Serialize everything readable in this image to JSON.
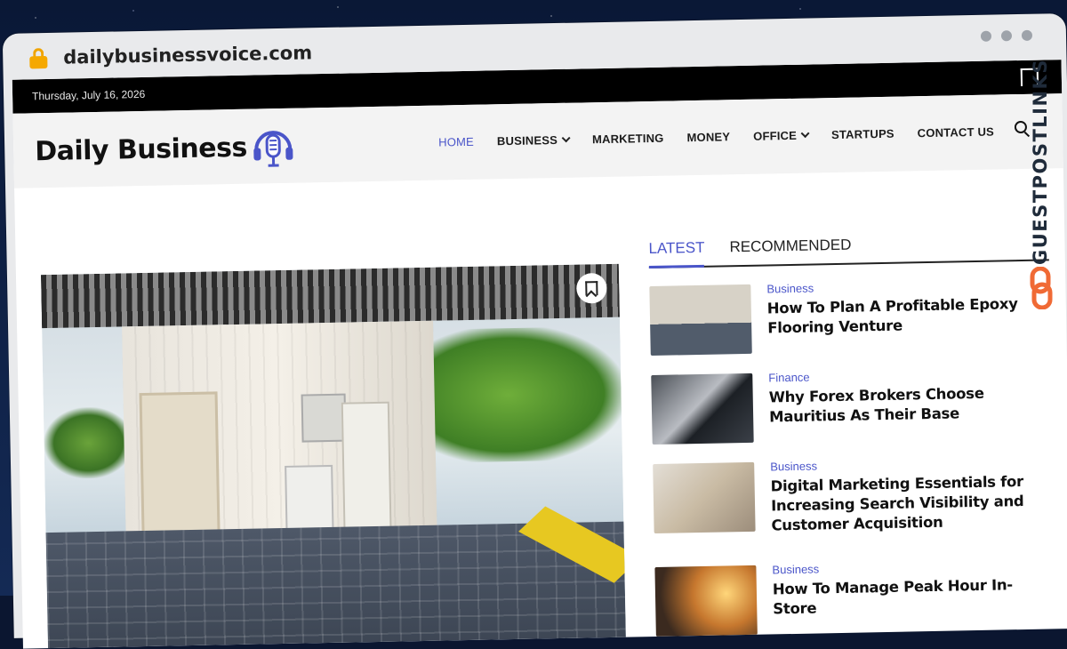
{
  "browser": {
    "url": "dailybusinessvoice.com"
  },
  "site": {
    "topbar": {
      "date": "Thursday, July 16, 2026"
    },
    "logo": {
      "text": "Daily Business"
    },
    "nav": {
      "items": [
        {
          "label": "HOME",
          "active": true,
          "dropdown": false
        },
        {
          "label": "BUSINESS",
          "active": false,
          "dropdown": true
        },
        {
          "label": "MARKETING",
          "active": false,
          "dropdown": false
        },
        {
          "label": "MONEY",
          "active": false,
          "dropdown": false
        },
        {
          "label": "OFFICE",
          "active": false,
          "dropdown": true
        },
        {
          "label": "STARTUPS",
          "active": false,
          "dropdown": false
        },
        {
          "label": "CONTACT US",
          "active": false,
          "dropdown": false
        }
      ]
    },
    "sidebar": {
      "tabs": [
        {
          "label": "LATEST"
        },
        {
          "label": "RECOMMENDED"
        }
      ],
      "posts": [
        {
          "category": "Business",
          "title": "How To Plan A Profitable Epoxy Flooring Venture"
        },
        {
          "category": "Finance",
          "title": "Why Forex Brokers Choose Mauritius As Their Base"
        },
        {
          "category": "Business",
          "title": "Digital Marketing Essentials for Increasing Search Visibility and Customer Acquisition"
        },
        {
          "category": "Business",
          "title": "How To Manage Peak Hour In-Store"
        }
      ]
    }
  },
  "overlay": {
    "brand": "GUESTPOSTLINKS"
  },
  "colors": {
    "accent": "#4a55c9",
    "brand_orange": "#f06a35",
    "topbar": "#000000"
  }
}
